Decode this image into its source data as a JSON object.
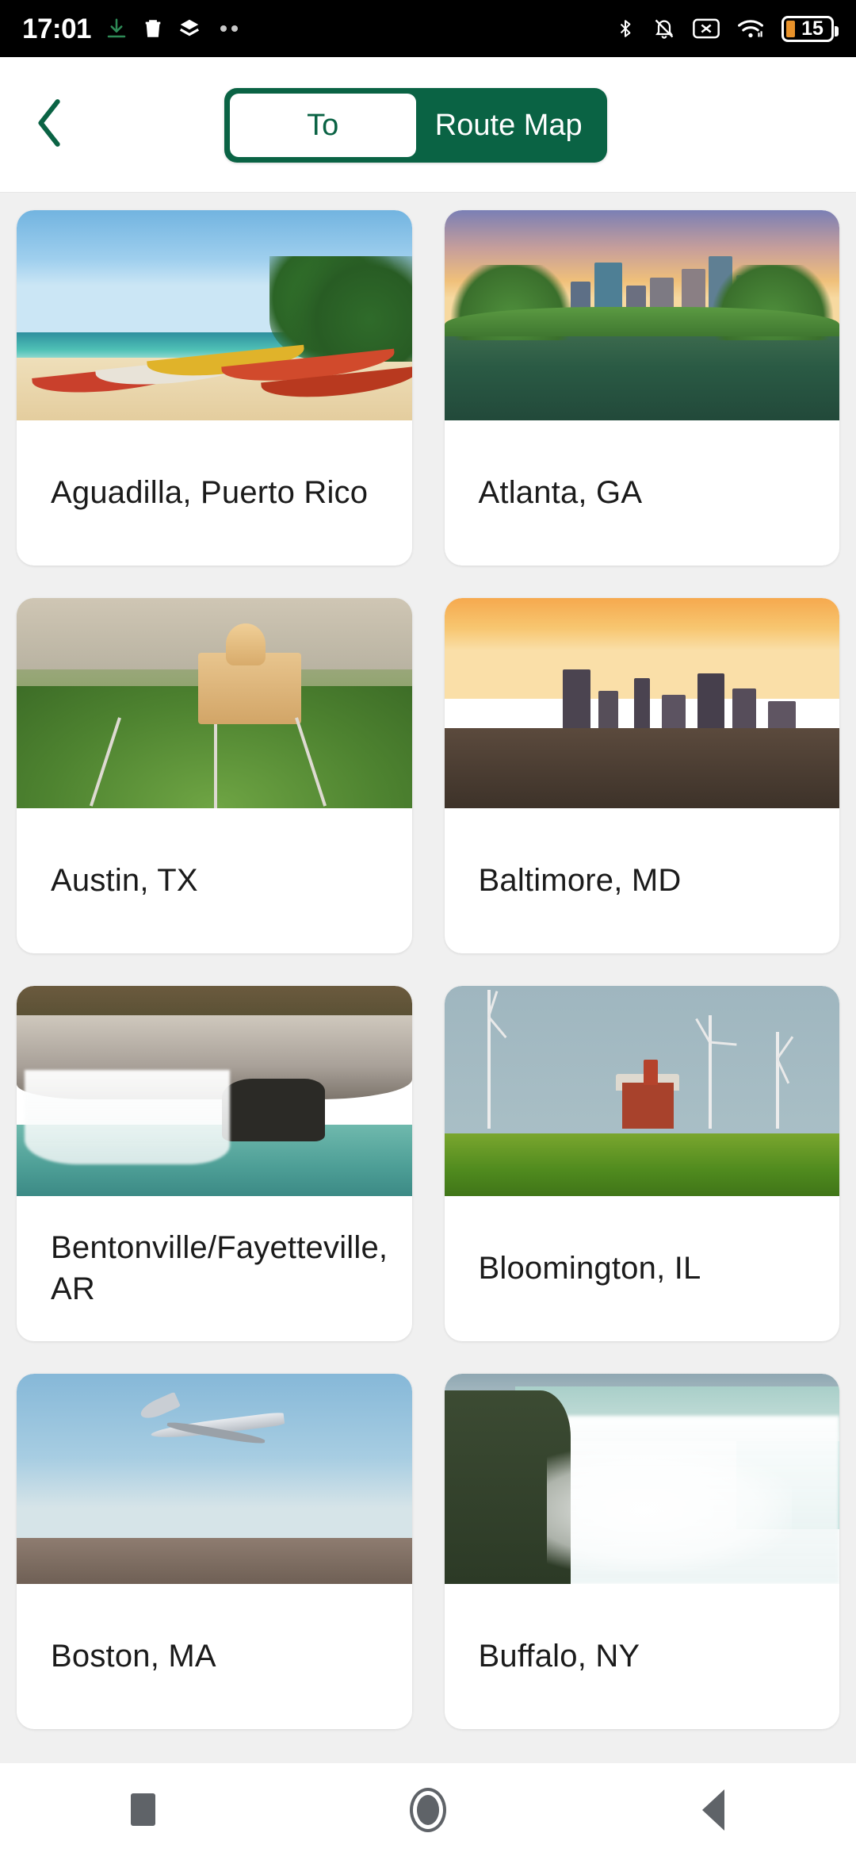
{
  "status_bar": {
    "time": "17:01",
    "left_icons": [
      "download-icon",
      "trash-icon",
      "layers-icon",
      "more-dots-icon"
    ],
    "right_icons": [
      "bluetooth-icon",
      "ringer-muted-icon",
      "sim-missing-icon",
      "wifi-icon"
    ],
    "battery_percent": "15",
    "battery_color": "#E8922A"
  },
  "header": {
    "back_icon": "chevron-left-icon",
    "accent_color": "#0A6344",
    "toggle": {
      "options": [
        "To",
        "Route Map"
      ],
      "selected": "To"
    }
  },
  "destinations": [
    {
      "name": "Aguadilla, Puerto Rico",
      "image": "beach-with-colorful-fishing-boats"
    },
    {
      "name": "Atlanta, GA",
      "image": "atlanta-skyline-reflected-in-lake-at-sunset"
    },
    {
      "name": "Austin, TX",
      "image": "texas-state-capitol-aerial-view"
    },
    {
      "name": "Baltimore, MD",
      "image": "baltimore-inner-harbor-at-dusk"
    },
    {
      "name": "Bentonville/Fayetteville, AR",
      "image": "waterfall-over-rock-ledge"
    },
    {
      "name": "Bloomington, IL",
      "image": "red-barn-with-wind-turbines-in-field"
    },
    {
      "name": "Boston, MA",
      "image": "airplane-landing-over-runway"
    },
    {
      "name": "Buffalo, NY",
      "image": "niagara-falls-horseshoe"
    }
  ],
  "nav_bar": {
    "buttons": [
      "recents-square-icon",
      "home-circle-icon",
      "back-triangle-icon"
    ]
  }
}
